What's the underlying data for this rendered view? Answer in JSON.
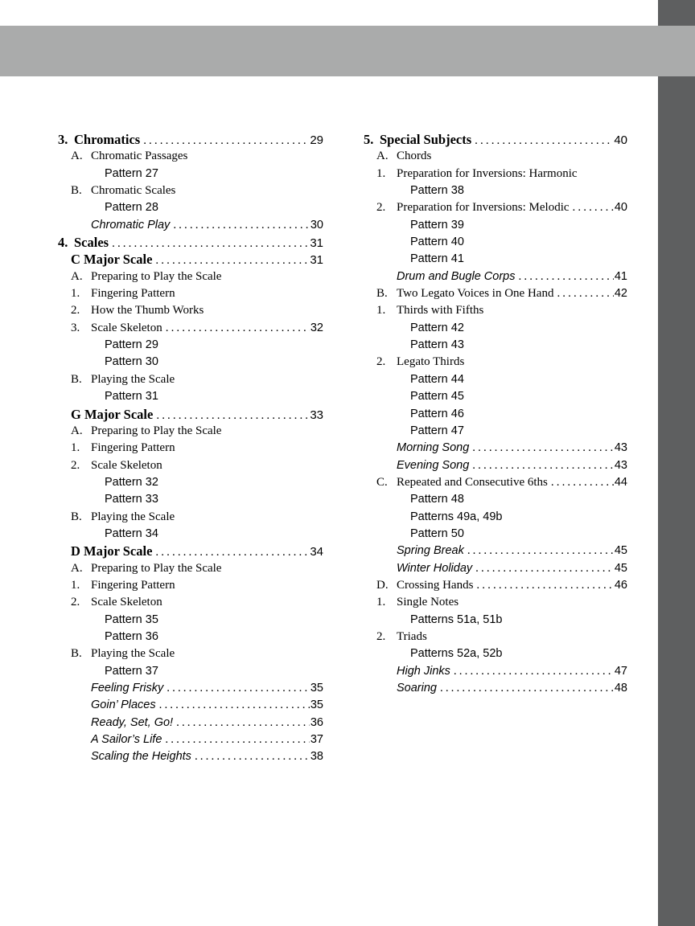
{
  "page": {
    "header_band_color": "#aaabab",
    "side_strip_color": "#5e5f60",
    "background_color": "#ffffff"
  },
  "toc": {
    "columns": [
      {
        "name": "left-column",
        "entries": [
          {
            "level": "chapter",
            "num": "3.",
            "title": "Chromatics",
            "page": "29",
            "leader": true
          },
          {
            "level": "sub",
            "num": "A.",
            "title": "Chromatic Passages",
            "page": "",
            "leader": false
          },
          {
            "level": "pattern",
            "num": "",
            "title": "Pattern 27",
            "page": "",
            "leader": false
          },
          {
            "level": "sub",
            "num": "B.",
            "title": "Chromatic Scales",
            "page": "",
            "leader": false
          },
          {
            "level": "pattern",
            "num": "",
            "title": "Pattern 28",
            "page": "",
            "leader": false
          },
          {
            "level": "piece",
            "num": "",
            "title": "Chromatic Play",
            "page": "30",
            "leader": true
          },
          {
            "level": "chapter",
            "num": "4.",
            "title": "Scales",
            "page": "31",
            "leader": true
          },
          {
            "level": "scale",
            "num": "",
            "title": "C Major Scale",
            "page": "31",
            "leader": true
          },
          {
            "level": "sub",
            "num": "A.",
            "title": "Preparing to Play the Scale",
            "page": "",
            "leader": false
          },
          {
            "level": "sub",
            "num": "1.",
            "title": "Fingering Pattern",
            "page": "",
            "leader": false
          },
          {
            "level": "sub",
            "num": "2.",
            "title": "How the Thumb Works",
            "page": "",
            "leader": false
          },
          {
            "level": "sub",
            "num": "3.",
            "title": "Scale Skeleton",
            "page": "32",
            "leader": true
          },
          {
            "level": "pattern",
            "num": "",
            "title": "Pattern 29",
            "page": "",
            "leader": false
          },
          {
            "level": "pattern",
            "num": "",
            "title": "Pattern 30",
            "page": "",
            "leader": false
          },
          {
            "level": "sub",
            "num": "B.",
            "title": "Playing the Scale",
            "page": "",
            "leader": false
          },
          {
            "level": "pattern",
            "num": "",
            "title": "Pattern 31",
            "page": "",
            "leader": false
          },
          {
            "level": "scale",
            "num": "",
            "title": "G Major Scale",
            "page": "33",
            "leader": true
          },
          {
            "level": "sub",
            "num": "A.",
            "title": "Preparing to Play the Scale",
            "page": "",
            "leader": false
          },
          {
            "level": "sub",
            "num": "1.",
            "title": "Fingering Pattern",
            "page": "",
            "leader": false
          },
          {
            "level": "sub",
            "num": "2.",
            "title": "Scale Skeleton",
            "page": "",
            "leader": false
          },
          {
            "level": "pattern",
            "num": "",
            "title": "Pattern 32",
            "page": "",
            "leader": false
          },
          {
            "level": "pattern",
            "num": "",
            "title": "Pattern 33",
            "page": "",
            "leader": false
          },
          {
            "level": "sub",
            "num": "B.",
            "title": "Playing the Scale",
            "page": "",
            "leader": false
          },
          {
            "level": "pattern",
            "num": "",
            "title": "Pattern 34",
            "page": "",
            "leader": false
          },
          {
            "level": "scale",
            "num": "",
            "title": "D Major Scale",
            "page": "34",
            "leader": true
          },
          {
            "level": "sub",
            "num": "A.",
            "title": "Preparing to Play the Scale",
            "page": "",
            "leader": false
          },
          {
            "level": "sub",
            "num": "1.",
            "title": "Fingering Pattern",
            "page": "",
            "leader": false
          },
          {
            "level": "sub",
            "num": "2.",
            "title": "Scale Skeleton",
            "page": "",
            "leader": false
          },
          {
            "level": "pattern",
            "num": "",
            "title": "Pattern 35",
            "page": "",
            "leader": false
          },
          {
            "level": "pattern",
            "num": "",
            "title": "Pattern 36",
            "page": "",
            "leader": false
          },
          {
            "level": "sub",
            "num": "B.",
            "title": "Playing the Scale",
            "page": "",
            "leader": false
          },
          {
            "level": "pattern",
            "num": "",
            "title": "Pattern 37",
            "page": "",
            "leader": false
          },
          {
            "level": "piece",
            "num": "",
            "title": "Feeling Frisky",
            "page": "35",
            "leader": true
          },
          {
            "level": "piece",
            "num": "",
            "title": "Goin’ Places",
            "page": "35",
            "leader": true
          },
          {
            "level": "piece",
            "num": "",
            "title": "Ready, Set, Go!",
            "page": "36",
            "leader": true
          },
          {
            "level": "piece",
            "num": "",
            "title": "A Sailor’s Life",
            "page": "37",
            "leader": true
          },
          {
            "level": "piece",
            "num": "",
            "title": "Scaling the Heights",
            "page": "38",
            "leader": true
          }
        ]
      },
      {
        "name": "right-column",
        "entries": [
          {
            "level": "chapter",
            "num": "5.",
            "title": "Special Subjects",
            "page": "40",
            "leader": true
          },
          {
            "level": "sub",
            "num": "A.",
            "title": "Chords",
            "page": "",
            "leader": false
          },
          {
            "level": "sub",
            "num": "1.",
            "title": "Preparation for Inversions:  Harmonic",
            "page": "",
            "leader": false
          },
          {
            "level": "pattern",
            "num": "",
            "title": "Pattern 38",
            "page": "",
            "leader": false
          },
          {
            "level": "sub",
            "num": "2.",
            "title": "Preparation for Inversions:  Melodic",
            "page": "40",
            "leader": true
          },
          {
            "level": "pattern",
            "num": "",
            "title": "Pattern 39",
            "page": "",
            "leader": false
          },
          {
            "level": "pattern",
            "num": "",
            "title": "Pattern 40",
            "page": "",
            "leader": false
          },
          {
            "level": "pattern",
            "num": "",
            "title": "Pattern 41",
            "page": "",
            "leader": false
          },
          {
            "level": "piece",
            "num": "",
            "title": "Drum and Bugle Corps",
            "page": "41",
            "leader": true
          },
          {
            "level": "sub",
            "num": "B.",
            "title": "Two Legato Voices in One Hand",
            "page": "42",
            "leader": true
          },
          {
            "level": "sub",
            "num": "1.",
            "title": "Thirds with Fifths",
            "page": "",
            "leader": false
          },
          {
            "level": "pattern",
            "num": "",
            "title": "Pattern 42",
            "page": "",
            "leader": false
          },
          {
            "level": "pattern",
            "num": "",
            "title": "Pattern 43",
            "page": "",
            "leader": false
          },
          {
            "level": "sub",
            "num": "2.",
            "title": "Legato Thirds",
            "page": "",
            "leader": false
          },
          {
            "level": "pattern",
            "num": "",
            "title": "Pattern 44",
            "page": "",
            "leader": false
          },
          {
            "level": "pattern",
            "num": "",
            "title": "Pattern 45",
            "page": "",
            "leader": false
          },
          {
            "level": "pattern",
            "num": "",
            "title": "Pattern 46",
            "page": "",
            "leader": false
          },
          {
            "level": "pattern",
            "num": "",
            "title": "Pattern 47",
            "page": "",
            "leader": false
          },
          {
            "level": "piece",
            "num": "",
            "title": "Morning Song",
            "page": "43",
            "leader": true
          },
          {
            "level": "piece",
            "num": "",
            "title": "Evening Song",
            "page": "43",
            "leader": true
          },
          {
            "level": "sub",
            "num": "C.",
            "title": "Repeated and Consecutive 6ths",
            "page": "44",
            "leader": true
          },
          {
            "level": "pattern",
            "num": "",
            "title": "Pattern 48",
            "page": "",
            "leader": false
          },
          {
            "level": "pattern",
            "num": "",
            "title": "Patterns 49a, 49b",
            "page": "",
            "leader": false
          },
          {
            "level": "pattern",
            "num": "",
            "title": "Pattern 50",
            "page": "",
            "leader": false
          },
          {
            "level": "piece",
            "num": "",
            "title": "Spring Break",
            "page": "45",
            "leader": true
          },
          {
            "level": "piece",
            "num": "",
            "title": "Winter Holiday",
            "page": "45",
            "leader": true
          },
          {
            "level": "sub",
            "num": "D.",
            "title": "Crossing Hands",
            "page": "46",
            "leader": true
          },
          {
            "level": "sub",
            "num": "1.",
            "title": "Single Notes",
            "page": "",
            "leader": false
          },
          {
            "level": "pattern",
            "num": "",
            "title": "Patterns 51a, 51b",
            "page": "",
            "leader": false
          },
          {
            "level": "sub",
            "num": "2.",
            "title": "Triads",
            "page": "",
            "leader": false
          },
          {
            "level": "pattern",
            "num": "",
            "title": "Patterns 52a, 52b",
            "page": "",
            "leader": false
          },
          {
            "level": "piece",
            "num": "",
            "title": "High Jinks",
            "page": "47",
            "leader": true
          },
          {
            "level": "piece",
            "num": "",
            "title": "Soaring",
            "page": "48",
            "leader": true
          }
        ]
      }
    ]
  }
}
